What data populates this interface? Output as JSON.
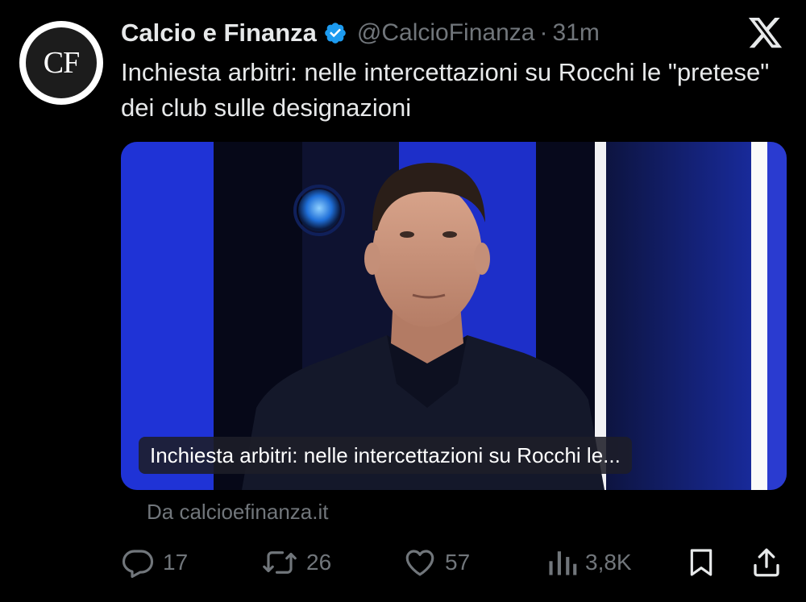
{
  "author": {
    "avatar_text": "CF",
    "display_name": "Calcio e Finanza",
    "handle": "@CalcioFinanza",
    "separator": "·",
    "time": "31m",
    "verified": true
  },
  "tweet": {
    "text": "Inchiesta arbitri: nelle intercettazioni su Rocchi le \"pretese\" dei club sulle designazioni"
  },
  "media": {
    "caption": "Inchiesta arbitri: nelle intercettazioni su Rocchi le...",
    "source": "Da calcioefinanza.it"
  },
  "actions": {
    "replies": "17",
    "reposts": "26",
    "likes": "57",
    "views": "3,8K"
  },
  "icons": {
    "platform": "x-logo-icon",
    "verified": "verified-badge-icon",
    "reply": "reply-icon",
    "repost": "repost-icon",
    "like": "heart-icon",
    "views": "views-icon",
    "bookmark": "bookmark-icon",
    "share": "share-icon"
  },
  "colors": {
    "background": "#000000",
    "text_primary": "#e7e9ea",
    "text_secondary": "#71767b",
    "verified": "#1d9bf0"
  }
}
